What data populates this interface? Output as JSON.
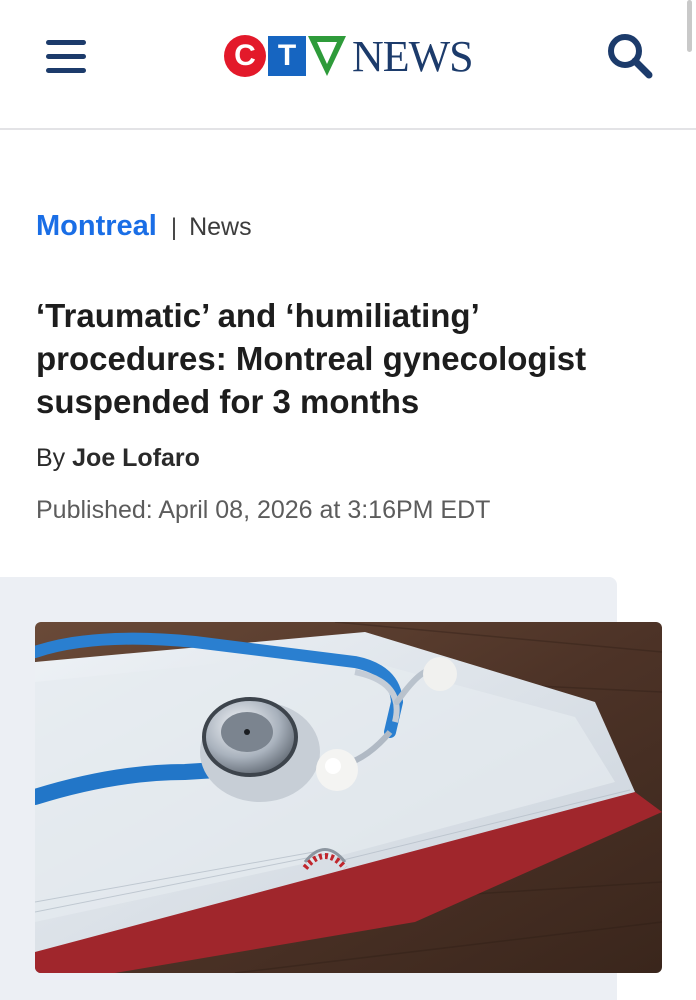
{
  "header": {
    "logo_c": "C",
    "logo_t": "T",
    "logo_news": "NEWS"
  },
  "icons": {
    "menu": "hamburger-menu-icon",
    "search": "search-icon"
  },
  "colors": {
    "brand_blue": "#1c3b6b",
    "link_blue": "#1a6ee6",
    "ctv_red": "#e3192a",
    "ctv_blue": "#1665c1",
    "ctv_green": "#2e9b3a"
  },
  "article": {
    "section": "Montreal",
    "separator": "|",
    "subsection": "News",
    "headline": "‘Traumatic’ and ‘humiliating’ procedures: Montreal gynecologist suspended for 3 months",
    "by_prefix": "By",
    "author": "Joe Lofaro",
    "published": "Published: April 08, 2026 at 3:16PM EDT"
  }
}
